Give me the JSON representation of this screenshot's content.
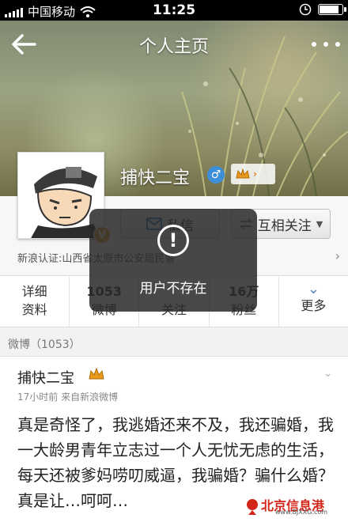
{
  "status_bar": {
    "carrier": "中国移动",
    "time": "11:25",
    "battery_level": 0.85
  },
  "nav": {
    "title": "个人主页"
  },
  "profile": {
    "name": "捕快二宝",
    "verified_badge": "V",
    "verification": "新浪认证:山西省太原市公安局民警",
    "message_label": "私信",
    "follow_label": "互相关注"
  },
  "stats": [
    {
      "num": "",
      "label_top": "详细",
      "label": "资料"
    },
    {
      "num": "1053",
      "label": "微博"
    },
    {
      "num": "",
      "label": "关注"
    },
    {
      "num": "16万",
      "label": "粉丝"
    },
    {
      "num": "",
      "label": "更多"
    }
  ],
  "section": {
    "label": "微博（1053）"
  },
  "post": {
    "author": "捕快二宝",
    "meta": "17小时前  来自新浪微博",
    "text": "真是奇怪了，我逃婚还来不及，我还骗婚，我一大龄男青年立志过一个人无忧无虑的生活，每天还被爹妈唠叨威逼，我骗婚？骗什么婚？真是让…呵呵…"
  },
  "toast": {
    "icon": "!",
    "text": "用户不存在"
  },
  "watermark": {
    "title": "北京信息港",
    "subtitle": "www.BJXXG.com"
  },
  "colors": {
    "accent": "#5a7fb8",
    "gender": "#3c8fd8",
    "verified": "#e8a33a"
  }
}
